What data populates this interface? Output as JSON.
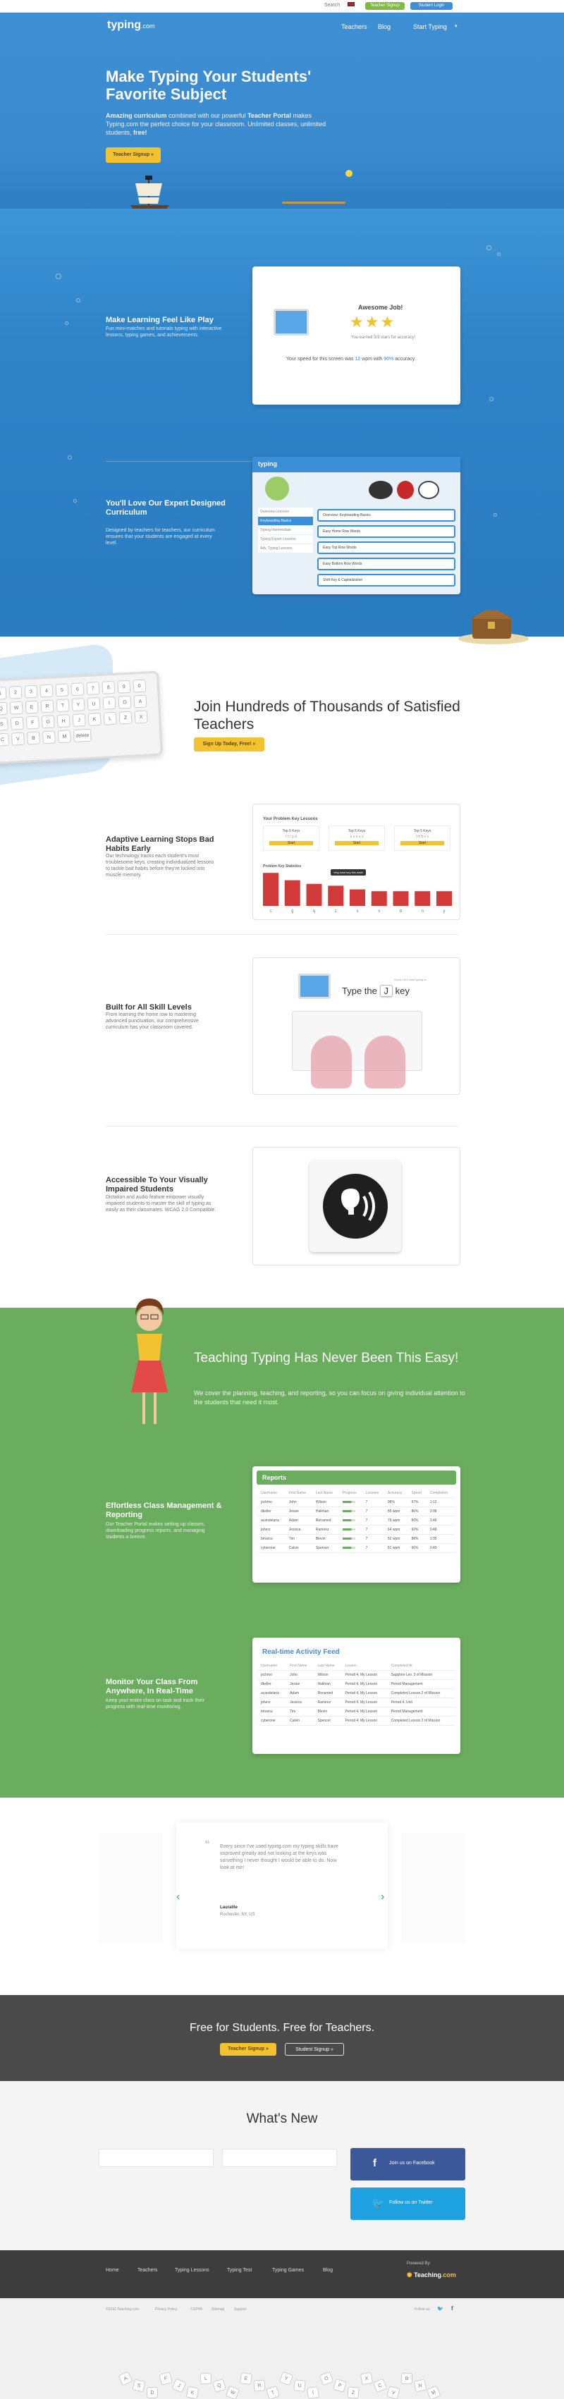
{
  "topbar": {
    "search": "Search",
    "signup": "Teacher Signup",
    "login": "Student Login"
  },
  "nav": {
    "logo": "typing",
    "logo_suffix": ".com",
    "teachers": "Teachers",
    "blog": "Blog",
    "start": "Start Typing"
  },
  "hero": {
    "title": "Make Typing Your Students' Favorite Subject",
    "subtitle_a": "Amazing curriculum",
    "subtitle_b": " combined with our powerful ",
    "subtitle_c": "Teacher Portal",
    "subtitle_d": " makes Typing.com the perfect choice for your classroom. Unlimited classes, unlimited students, ",
    "subtitle_e": "free!",
    "button": "Teacher Signup »"
  },
  "features_blue": [
    {
      "title": "Make Learning Feel Like Play",
      "text": "Fun mini-matches and tutorials typing with interactive lessons, typing games, and achievements."
    },
    {
      "title": "You'll Love Our Expert Designed Curriculum",
      "text": "Designed by teachers for teachers, our curriculum ensures that your students are engaged at every level."
    }
  ],
  "award_card": {
    "title": "Awesome Job!",
    "earned": "You earned 3/3 stars for accuracy!",
    "speed_a": "Your speed for this screen was ",
    "speed_wpm": "12",
    "speed_b": " wpm with ",
    "speed_acc": "96%",
    "speed_c": " accuracy."
  },
  "curriculum_card": {
    "logo": "typing",
    "items": [
      "Overview Lessons",
      "Keyboarding Basics",
      "Typing Intermediate",
      "Typing Expert Lessons",
      "Adv. Typing Lessons"
    ],
    "lessons": [
      "Overview: Keyboarding Basics",
      "Easy Home Row Words",
      "Easy Top Row Words",
      "Easy Bottom Row Words",
      "Shift Key & Capitalization"
    ]
  },
  "join": {
    "title": "Join Hundreds of Thousands of Satisfied Teachers",
    "button": "Sign Up Today, Free! »"
  },
  "keyboard_keys": [
    "1",
    "2",
    "3",
    "4",
    "5",
    "6",
    "7",
    "8",
    "9",
    "0",
    "Q",
    "W",
    "E",
    "R",
    "T",
    "Y",
    "U",
    "I",
    "O",
    "A",
    "S",
    "D",
    "F",
    "G",
    "H",
    "J",
    "K",
    "L",
    "Z",
    "X",
    "C",
    "V",
    "B",
    "N",
    "M",
    "delete"
  ],
  "features_white": [
    {
      "title": "Adaptive Learning Stops Bad Habits Early",
      "text": "Our technology tracks each student's most troublesome keys, creating individualized lessons to tackle bad habits before they're locked into muscle memory."
    },
    {
      "title": "Built for All Skill Levels",
      "text": "From learning the home row to mastering advanced punctuation, our comprehensive curriculum has your classroom covered."
    },
    {
      "title": "Accessible To Your Visually Impaired Students",
      "text": "Dictation and audio feature empower visually impaired students to master the skill of typing as easily as their classmates. WCAG 2.0 Compatible."
    }
  ],
  "problem_keys": {
    "title": "Your Problem Key Lessons",
    "cards": [
      {
        "label": "Top 5 Keys",
        "keys": "t f r g d"
      },
      {
        "label": "Top 5 Keys",
        "keys": "a s e u y"
      },
      {
        "label": "Top 5 Keys",
        "keys": "l m b v c"
      }
    ],
    "start": "Start",
    "stats_title": "Problem Key Statistics",
    "tooltip": "Very hard key this week",
    "keys": [
      "c",
      "g",
      "q",
      "z",
      "x",
      "v",
      "b",
      "n",
      "y"
    ],
    "values": [
      90,
      70,
      60,
      55,
      45,
      40,
      40,
      40,
      40
    ]
  },
  "skill_card": {
    "hint": "Good, Let's start typing in:",
    "prompt_a": "Type the",
    "key": "J",
    "prompt_b": "key"
  },
  "green": {
    "title": "Teaching Typing Has Never Been This Easy!",
    "subtitle": "We cover the planning, teaching, and reporting, so you can focus on giving individual attention to the students that need it most.",
    "features": [
      {
        "title": "Effortless Class Management & Reporting",
        "text": "Our Teacher Portal makes setting up classes, downloading progress reports, and managing students a breeze."
      },
      {
        "title": "Monitor Your Class From Anywhere, In Real-Time",
        "text": "Keep your entire class on task and track their progress with real-time monitoring."
      }
    ]
  },
  "reports": {
    "title": "Reports",
    "headers": [
      "Username",
      "First Name",
      "Last Name",
      "Progress",
      "Lessons",
      "Accuracy",
      "Speed",
      "Completion"
    ],
    "rows": [
      [
        "jschmo",
        "John",
        "Wilson",
        "",
        "7",
        "98%",
        "97%",
        "1:12"
      ],
      [
        "dkeller",
        "Jessie",
        "Hallman",
        "",
        "7",
        "85 wpm",
        "86%",
        "2:08"
      ],
      [
        "acandelaria",
        "Adam",
        "Renamed",
        "",
        "7",
        "79 wpm",
        "80%",
        "1:46"
      ],
      [
        "joherz",
        "Jessica",
        "Ramirez",
        "",
        "7",
        "64 wpm",
        "92%",
        "0:48"
      ],
      [
        "bmarcu",
        "Tim",
        "Blevin",
        "",
        "7",
        "52 wpm",
        "88%",
        "1:35"
      ],
      [
        "cyberone",
        "Calvin",
        "Spencer",
        "",
        "7",
        "81 wpm",
        "96%",
        "0:49"
      ]
    ]
  },
  "feed": {
    "title": "Real-time Activity Feed",
    "headers": [
      "Username",
      "First Name",
      "Last Name",
      "Lesson",
      "Completed At"
    ],
    "rows": [
      [
        "jschmo",
        "John",
        "Wilson",
        "Period 4, My Lesson",
        "Sapphire Lev. 3 of Mission"
      ],
      [
        "dkeller",
        "Jessie",
        "Hallman",
        "Period 4, My Lesson",
        "Period Management"
      ],
      [
        "acandelaria",
        "Adam",
        "Renamed",
        "Period 4, My Lesson",
        "Completed Lesson 2 of Mission"
      ],
      [
        "joherz",
        "Jessica",
        "Ramirez",
        "Period 4, My Lesson",
        "Period 4, Unit"
      ],
      [
        "bmarcu",
        "Tim",
        "Blevin",
        "Period 4, My Lesson",
        "Period Management"
      ],
      [
        "cyberone",
        "Calvin",
        "Spencer",
        "Period 4, My Lesson",
        "Completed Lesson 2 of Mission"
      ]
    ]
  },
  "testimonial": {
    "quote": "Every since I've used typing.com my typing skills have improved greatly and not looking at the keys was something I never thought I would be able to do. Now look at me!",
    "name": "Lauralite",
    "location": "Rochester, NY, US"
  },
  "cta": {
    "title": "Free for Students. Free for Teachers.",
    "teacher": "Teacher Signup »",
    "student": "Student Signup »"
  },
  "news": {
    "title": "What's New",
    "facebook": "Join us on Facebook",
    "twitter": "Follow us on Twitter"
  },
  "footer": {
    "links": [
      "Home",
      "Teachers",
      "Typing Lessons",
      "Typing Test",
      "Typing Games",
      "Blog"
    ],
    "powered": "Powered By:",
    "brand": "Teaching",
    "brand_suffix": ".com",
    "copyright": "©2016 Teaching.com",
    "legal": [
      "Privacy Policy",
      "COPPA",
      "Sitemap",
      "Support"
    ],
    "follow": "Follow us:"
  },
  "colors": {
    "accent": "#f2c230",
    "green": "#6aad5e",
    "blue": "#2f84c8",
    "dark": "#4a4a4a",
    "facebook": "#3b5998",
    "twitter": "#1da1e0"
  }
}
